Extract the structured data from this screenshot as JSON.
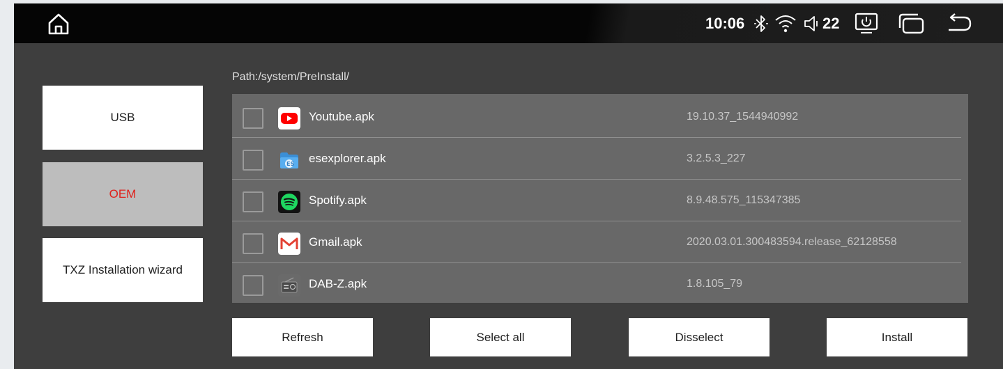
{
  "status_bar": {
    "home_icon": "home-icon",
    "time": "10:06",
    "bluetooth_icon": "bluetooth-icon",
    "wifi_icon": "wifi-icon",
    "volume_icon": "volume-icon",
    "volume_level": "22",
    "screen_off_icon": "screen-power-icon",
    "recent_apps_icon": "recent-apps-icon",
    "back_icon": "back-icon"
  },
  "sidebar": {
    "items": [
      {
        "label": "USB",
        "active": false
      },
      {
        "label": "OEM",
        "active": true
      },
      {
        "label": "TXZ Installation wizard",
        "active": false
      }
    ]
  },
  "main": {
    "path": "Path:/system/PreInstall/",
    "files": [
      {
        "name": "Youtube.apk",
        "version": "19.10.37_1544940992",
        "icon": "youtube-icon",
        "checked": false
      },
      {
        "name": "esexplorer.apk",
        "version": "3.2.5.3_227",
        "icon": "es-explorer-icon",
        "checked": false
      },
      {
        "name": "Spotify.apk",
        "version": "8.9.48.575_115347385",
        "icon": "spotify-icon",
        "checked": false
      },
      {
        "name": "Gmail.apk",
        "version": "2020.03.01.300483594.release_62128558",
        "icon": "gmail-icon",
        "checked": false
      },
      {
        "name": "DAB-Z.apk",
        "version": "1.8.105_79",
        "icon": "dab-radio-icon",
        "checked": false
      }
    ]
  },
  "actions": {
    "refresh": "Refresh",
    "select_all": "Select all",
    "disselect": "Disselect",
    "install": "Install"
  },
  "colors": {
    "active_text": "#e0201b",
    "active_bg": "#bdbdbd",
    "list_bg": "#686868",
    "screen_bg": "#3e3e3e"
  }
}
